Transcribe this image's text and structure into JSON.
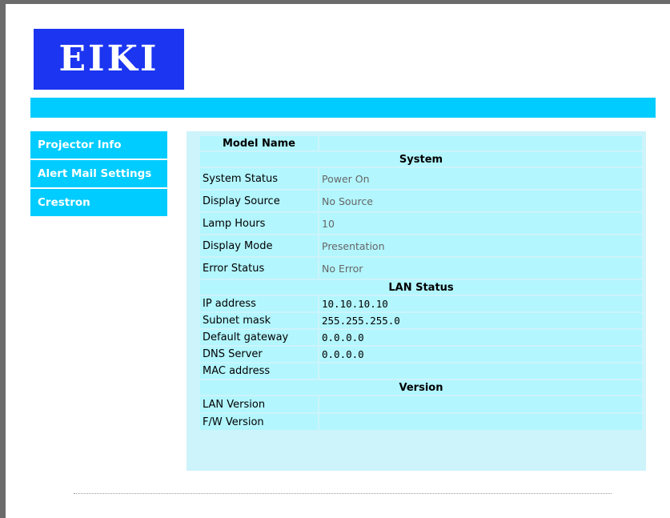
{
  "brand": {
    "logo_text": "EIKI",
    "color": "#1c35f0",
    "accent": "#00ccff"
  },
  "nav": {
    "items": [
      {
        "label": "Projector Info"
      },
      {
        "label": "Alert Mail Settings"
      },
      {
        "label": "Crestron"
      }
    ]
  },
  "info": {
    "model_name_label": "Model Name",
    "model_name_value": "",
    "system_header": "System",
    "system": [
      {
        "label": "System Status",
        "value": "Power On"
      },
      {
        "label": "Display Source",
        "value": "No Source"
      },
      {
        "label": "Lamp Hours",
        "value": "10"
      },
      {
        "label": "Display Mode",
        "value": "Presentation"
      },
      {
        "label": "Error Status",
        "value": "No Error"
      }
    ],
    "lan_header": "LAN Status",
    "lan": [
      {
        "label": "IP address",
        "value": "10.10.10.10"
      },
      {
        "label": "Subnet mask",
        "value": "255.255.255.0"
      },
      {
        "label": "Default gateway",
        "value": "0.0.0.0"
      },
      {
        "label": "DNS Server",
        "value": "0.0.0.0"
      },
      {
        "label": "MAC address",
        "value": ""
      }
    ],
    "version_header": "Version",
    "version": [
      {
        "label": "LAN Version",
        "value": ""
      },
      {
        "label": "F/W Version",
        "value": ""
      }
    ]
  }
}
